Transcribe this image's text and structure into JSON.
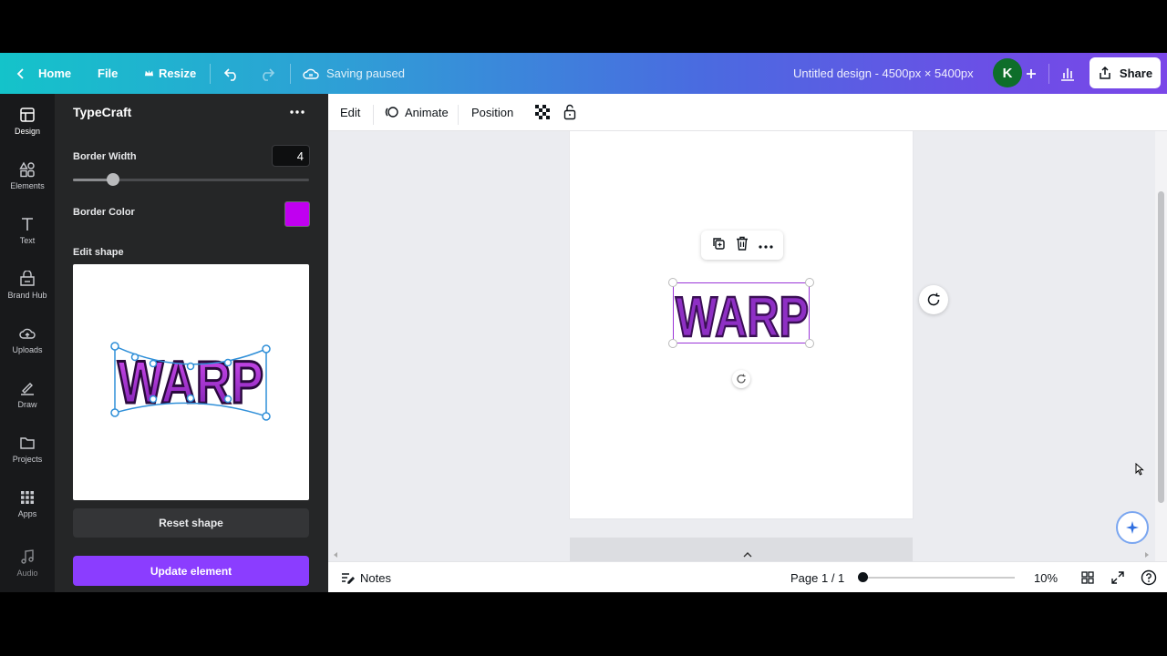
{
  "topbar": {
    "home_label": "Home",
    "file_label": "File",
    "resize_label": "Resize",
    "saving_status": "Saving paused",
    "design_title": "Untitled design - 4500px × 5400px",
    "avatar_initial": "K",
    "share_label": "Share"
  },
  "rail": {
    "items": [
      {
        "label": "Design",
        "icon": "design-icon"
      },
      {
        "label": "Elements",
        "icon": "elements-icon"
      },
      {
        "label": "Text",
        "icon": "text-icon"
      },
      {
        "label": "Brand Hub",
        "icon": "brand-hub-icon"
      },
      {
        "label": "Uploads",
        "icon": "uploads-icon"
      },
      {
        "label": "Draw",
        "icon": "draw-icon"
      },
      {
        "label": "Projects",
        "icon": "projects-icon"
      },
      {
        "label": "Apps",
        "icon": "apps-icon"
      },
      {
        "label": "Audio",
        "icon": "audio-icon"
      }
    ]
  },
  "panel": {
    "title": "TypeCraft",
    "border_width_label": "Border Width",
    "border_width_value": "4",
    "border_width_slider_fraction": 0.17,
    "border_color_label": "Border Color",
    "border_color": "#c000f0",
    "edit_shape_label": "Edit shape",
    "preview_text": "WARP",
    "reset_label": "Reset shape",
    "update_label": "Update element"
  },
  "toolbar": {
    "edit_label": "Edit",
    "animate_label": "Animate",
    "position_label": "Position"
  },
  "canvas": {
    "element_text": "WARP",
    "text_fill": "#8e2fc4",
    "text_stroke": "#3a0f55"
  },
  "footer": {
    "notes_label": "Notes",
    "page_indicator": "Page 1 / 1",
    "zoom_level": "10%",
    "zoom_fraction": 0
  },
  "colors": {
    "accent_purple": "#8b3dff",
    "panel_bg": "#252627"
  }
}
